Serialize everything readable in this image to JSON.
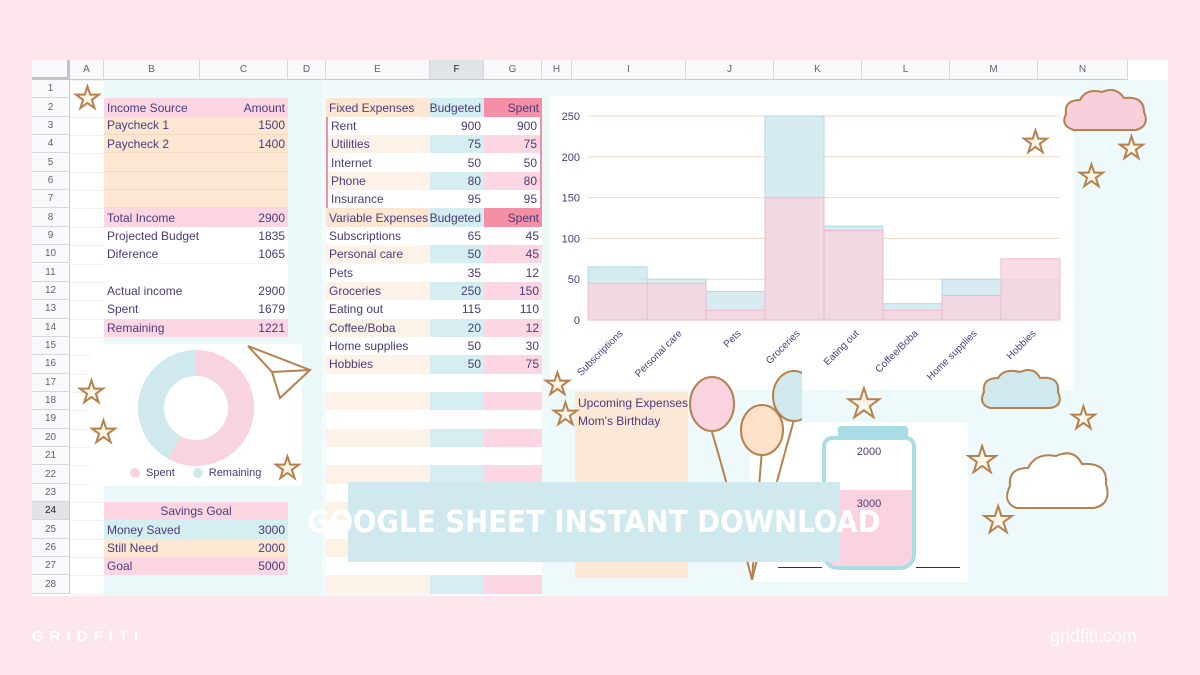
{
  "columns": [
    "A",
    "B",
    "C",
    "D",
    "E",
    "F",
    "G",
    "H",
    "I",
    "J",
    "K",
    "L",
    "M",
    "N"
  ],
  "rows": [
    "1",
    "2",
    "3",
    "4",
    "5",
    "6",
    "7",
    "8",
    "9",
    "10",
    "11",
    "12",
    "13",
    "14",
    "15",
    "16",
    "17",
    "18",
    "19",
    "20",
    "21",
    "22",
    "23",
    "24",
    "25",
    "26",
    "27",
    "28"
  ],
  "income": {
    "header": [
      "Income Source",
      "Amount"
    ],
    "rows": [
      [
        "Paycheck 1",
        "1500"
      ],
      [
        "Paycheck 2",
        "1400"
      ],
      [
        "",
        ""
      ],
      [
        "",
        ""
      ],
      [
        "",
        ""
      ]
    ],
    "total": [
      "Total Income",
      "2900"
    ],
    "projected": [
      "Projected Budget",
      "1835"
    ],
    "difference": [
      "Diference",
      "1065"
    ],
    "actual": [
      "Actual income",
      "2900"
    ],
    "spent": [
      "Spent",
      "1679"
    ],
    "remaining": [
      "Remaining",
      "1221"
    ]
  },
  "fixed_expenses": {
    "header": [
      "Fixed Expenses",
      "Budgeted",
      "Spent"
    ],
    "rows": [
      [
        "Rent",
        "900",
        "900"
      ],
      [
        "Utilities",
        "75",
        "75"
      ],
      [
        "Internet",
        "50",
        "50"
      ],
      [
        "Phone",
        "80",
        "80"
      ],
      [
        "Insurance",
        "95",
        "95"
      ]
    ]
  },
  "variable_expenses": {
    "header": [
      "Variable Expenses",
      "Budgeted",
      "Spent"
    ],
    "rows": [
      [
        "Subscriptions",
        "65",
        "45"
      ],
      [
        "Personal care",
        "50",
        "45"
      ],
      [
        "Pets",
        "35",
        "12"
      ],
      [
        "Groceries",
        "250",
        "150"
      ],
      [
        "Eating out",
        "115",
        "110"
      ],
      [
        "Coffee/Boba",
        "20",
        "12"
      ],
      [
        "Home supplies",
        "50",
        "30"
      ],
      [
        "Hobbies",
        "50",
        "75"
      ]
    ]
  },
  "donut": {
    "legend": [
      "Spent",
      "Remaining"
    ],
    "colors": [
      "#f8d3e0",
      "#cfe9ef"
    ]
  },
  "savings": {
    "title": "Savings Goal",
    "rows": [
      [
        "Money Saved",
        "3000"
      ],
      [
        "Still Need",
        "2000"
      ],
      [
        "Goal",
        "5000"
      ]
    ]
  },
  "upcoming": {
    "title": "Upcoming Expenses",
    "items": [
      "Mom's Birthday"
    ]
  },
  "jar": {
    "top_label": "2000",
    "bottom_label": "3000"
  },
  "banner": {
    "text": "GOOGLE SHEET INSTANT DOWNLOAD"
  },
  "footer": {
    "left": "GRIDFITI",
    "right": "gridfiti.com"
  },
  "chart_data": {
    "type": "area",
    "categories": [
      "Subscriptions",
      "Personal care",
      "Pets",
      "Groceries",
      "Eating out",
      "Coffee/Boba",
      "Home supplies",
      "Hobbies"
    ],
    "series": [
      {
        "values": [
          65,
          50,
          35,
          250,
          115,
          20,
          50,
          50
        ],
        "color": "#cfe9ef"
      },
      {
        "values": [
          45,
          45,
          12,
          150,
          110,
          12,
          30,
          75
        ],
        "color": "#f8d3e0"
      }
    ],
    "ylim": [
      0,
      250
    ],
    "yticks": [
      "0",
      "50",
      "100",
      "150",
      "200",
      "250"
    ],
    "grid": true
  }
}
